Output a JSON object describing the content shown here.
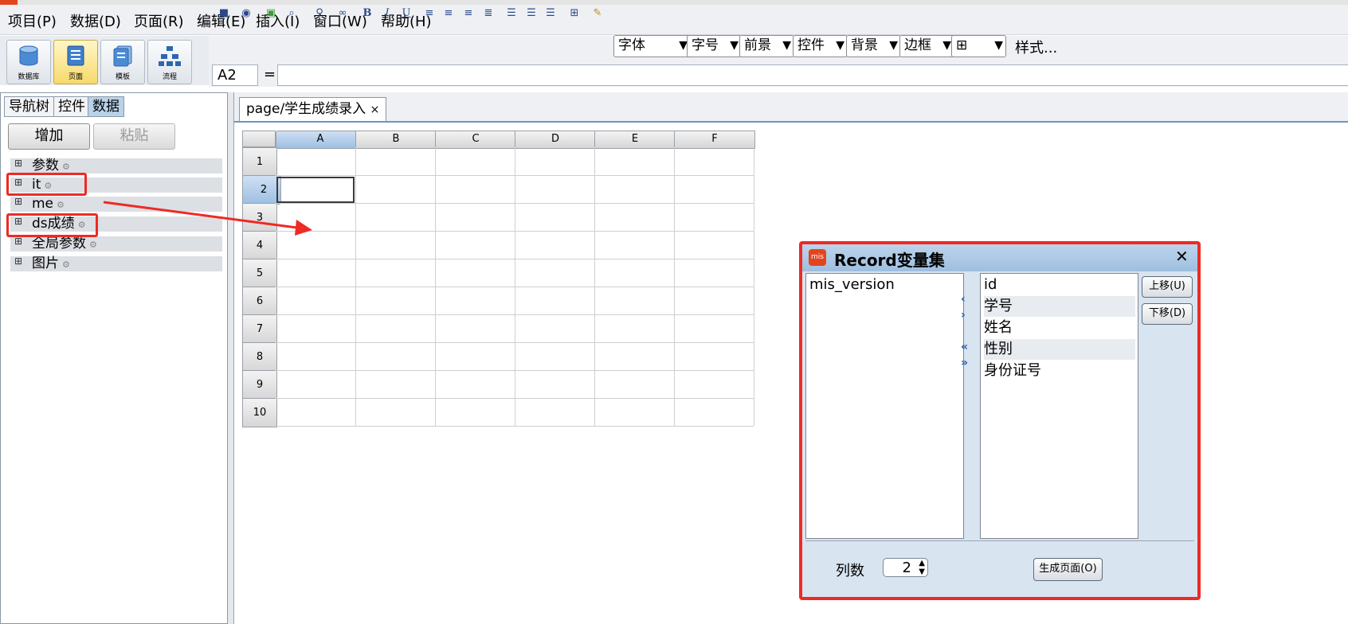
{
  "menu": [
    "项目(P)",
    "数据(D)",
    "页面(R)",
    "编辑(E)",
    "插入(I)",
    "窗口(W)",
    "帮助(H)"
  ],
  "big_toolbar": [
    {
      "label": "数据库",
      "icon": "database-icon"
    },
    {
      "label": "页面",
      "icon": "page-icon"
    },
    {
      "label": "模板",
      "icon": "template-icon"
    },
    {
      "label": "流程",
      "icon": "flow-icon"
    }
  ],
  "format_toolbar": {
    "bold": "B",
    "italic": "I",
    "underline": "U",
    "selects": {
      "font": "字体",
      "size": "字号",
      "foreground": "前景",
      "control": "控件",
      "background": "背景",
      "border": "边框"
    },
    "style_label": "样式..."
  },
  "formula_bar": {
    "cell_ref": "A2",
    "equals": "=",
    "formula": ""
  },
  "left_panel": {
    "tabs": [
      "导航树",
      "控件",
      "数据"
    ],
    "active_tab": "数据",
    "add_button": "增加",
    "paste_button": "粘贴",
    "tree": [
      "参数",
      "it",
      "me",
      "ds成绩",
      "全局参数",
      "图片"
    ]
  },
  "doc_tab": {
    "label": "page/学生成绩录入",
    "close": "×"
  },
  "grid": {
    "columns": [
      "A",
      "B",
      "C",
      "D",
      "E",
      "F"
    ],
    "rows": [
      "1",
      "2",
      "3",
      "4",
      "5",
      "6",
      "7",
      "8",
      "9",
      "10"
    ],
    "selected_cell": "A2"
  },
  "dialog": {
    "title": "Record变量集",
    "close": "✕",
    "left_list": [
      "mis_version"
    ],
    "right_list": [
      "id",
      "学号",
      "姓名",
      "性别",
      "身份证号"
    ],
    "up_button": "上移(U)",
    "down_button": "下移(D)",
    "columns_label": "列数",
    "columns_value": "2",
    "generate_button": "生成页面(O)"
  },
  "colors": {
    "highlight": "#ee2a24",
    "selection": "#9dbfe3"
  }
}
